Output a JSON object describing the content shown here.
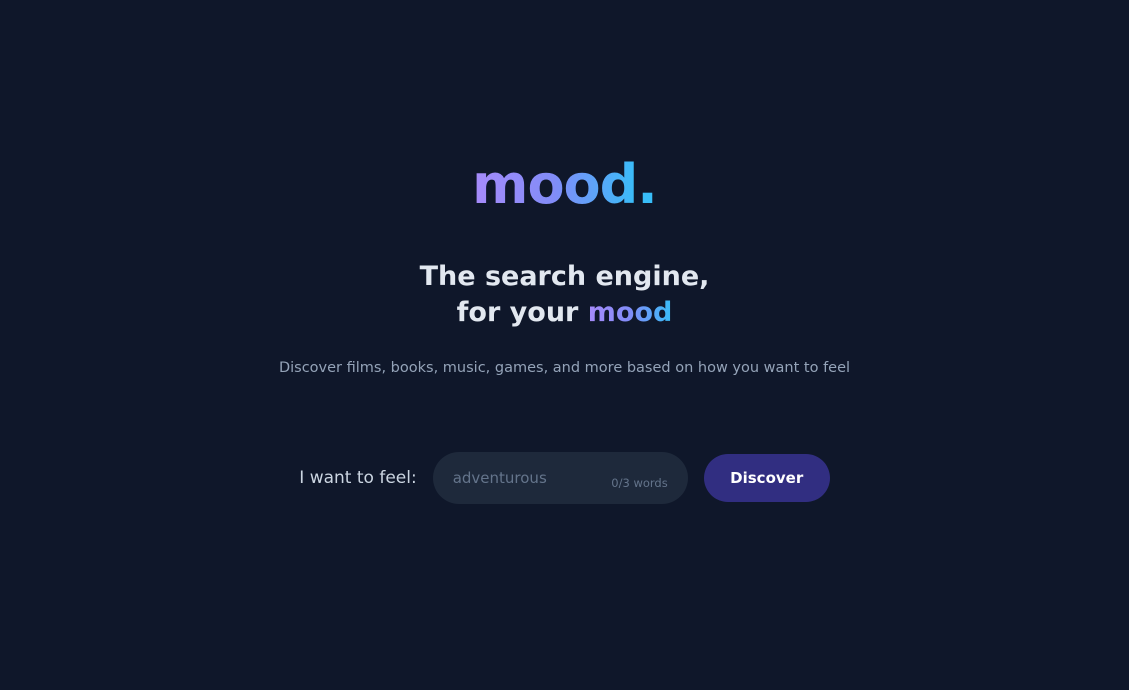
{
  "logo": {
    "word": "mood",
    "dot": "."
  },
  "headline": {
    "line1": "The search engine,",
    "line2_prefix": "for your",
    "line2_accent": "mood"
  },
  "subtitle": "Discover films, books, music, games, and more based on how you want to feel",
  "search": {
    "label": "I want to feel:",
    "placeholder": "adventurous",
    "value": "",
    "word_count": "0/3 words",
    "button_label": "Discover"
  },
  "colors": {
    "background": "#0f172a",
    "gradient_start": "#a78bfa",
    "gradient_end": "#38bdf8",
    "input_background": "#1e293b",
    "button_background": "#312e81"
  }
}
